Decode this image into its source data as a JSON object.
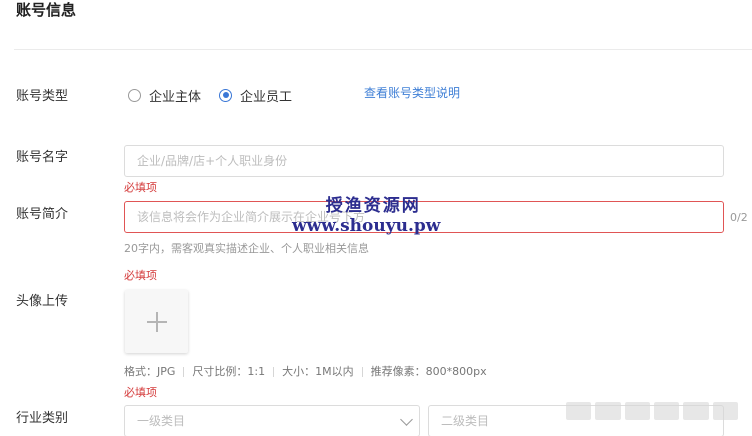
{
  "section": {
    "title": "账号信息"
  },
  "account_type": {
    "label": "账号类型",
    "options": [
      {
        "label": "企业主体",
        "checked": false
      },
      {
        "label": "企业员工",
        "checked": true
      }
    ],
    "help_link": "查看账号类型说明"
  },
  "account_name": {
    "label": "账号名字",
    "placeholder": "企业/品牌/店+个人职业身份",
    "required_text": "必填项"
  },
  "account_intro": {
    "label": "账号简介",
    "placeholder": "该信息将会作为企业简介展示在企业号下方",
    "counter": "0/2",
    "hint": "20字内，需客观真实描述企业、个人职业相关信息",
    "required_text": "必填项"
  },
  "avatar": {
    "label": "头像上传",
    "specs": [
      "格式：JPG",
      "尺寸比例：1:1",
      "大小：1M以内",
      "推荐像素：800*800px"
    ],
    "required_text": "必填项"
  },
  "industry": {
    "label": "行业类别",
    "primary_placeholder": "一级类目",
    "secondary_placeholder": "二级类目"
  },
  "watermark": {
    "cn": "授渔资源网",
    "url": "www.shouyu.pw"
  },
  "colors": {
    "accent": "#3a77d6",
    "link": "#3f7fd6",
    "error": "#d43a3a",
    "watermark": "#2c2d8f"
  }
}
